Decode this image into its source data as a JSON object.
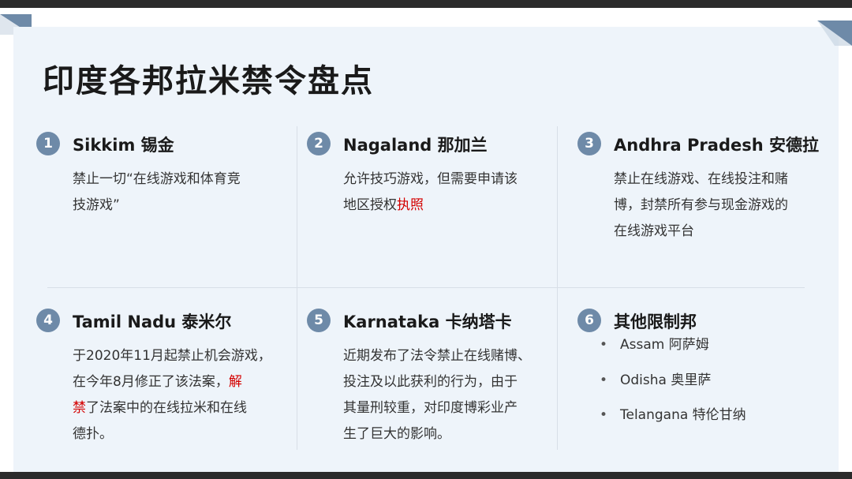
{
  "title": "印度各邦拉米禁令盘点",
  "cards": [
    {
      "num": "1",
      "heading": "Sikkim 锡金",
      "lines": [
        "禁止一切“在线游戏和体育竞",
        "技游戏”"
      ]
    },
    {
      "num": "2",
      "heading": "Nagaland 那加兰",
      "line1": "允许技巧游戏，但需要申请该",
      "line2_prefix": "地区授权",
      "line2_highlight": "执照"
    },
    {
      "num": "3",
      "heading": "Andhra Pradesh 安德拉",
      "lines": [
        "禁止在线游戏、在线投注和赌",
        "博，封禁所有参与现金游戏的",
        "在线游戏平台"
      ]
    },
    {
      "num": "4",
      "heading": "Tamil Nadu 泰米尔",
      "line1": "于2020年11月起禁止机会游戏，",
      "line2_prefix": "在今年8月修正了该法案，",
      "line2_highlight": "解",
      "line3_highlight": "禁",
      "line3_suffix": "了法案中的在线拉米和在线",
      "line4": "德扑。"
    },
    {
      "num": "5",
      "heading": "Karnataka 卡纳塔卡",
      "lines": [
        "近期发布了法令禁止在线赌博、",
        "投注及以此获利的行为，由于",
        "其量刑较重，对印度博彩业产",
        "生了巨大的影响。"
      ]
    },
    {
      "num": "6",
      "heading": "其他限制邦",
      "bullet": "•",
      "items": [
        "Assam 阿萨姆",
        "Odisha 奥里萨",
        "Telangana 特伦甘纳"
      ]
    }
  ],
  "colors": {
    "accent": "#6e8aa8",
    "highlight": "#d40000",
    "panel": "#eef4fa"
  }
}
